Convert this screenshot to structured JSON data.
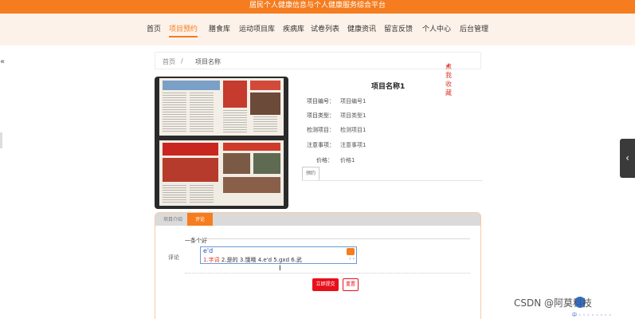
{
  "header": {
    "title": "居民个人健康信息与个人健康服务综合平台"
  },
  "nav": {
    "items": [
      {
        "label": "首页",
        "active": false
      },
      {
        "label": "项目预约",
        "active": true
      },
      {
        "label": "膳食库",
        "active": false
      },
      {
        "label": "运动项目库",
        "active": false
      },
      {
        "label": "疾病库",
        "active": false
      },
      {
        "label": "试卷列表",
        "active": false
      },
      {
        "label": "健康资讯",
        "active": false
      },
      {
        "label": "留言反馈",
        "active": false
      },
      {
        "label": "个人中心",
        "active": false
      },
      {
        "label": "后台管理",
        "active": false
      }
    ]
  },
  "left_arrow": "«",
  "breadcrumb": {
    "home": "首页",
    "separator": "/",
    "current": "项目名称",
    "favorite_label": "点我收藏",
    "favorite_icon": "star-icon"
  },
  "product": {
    "title": "项目名称1",
    "fields": [
      {
        "label": "项目编号：",
        "value": "项目编号1"
      },
      {
        "label": "项目类型：",
        "value": "项目类型1"
      },
      {
        "label": "检测项目：",
        "value": "检测项目1"
      },
      {
        "label": "注意事项：",
        "value": "注意事项1"
      },
      {
        "label": "价格：",
        "value": "价格1"
      }
    ],
    "small_tab": "预约"
  },
  "detail_tabs": [
    {
      "label": "项目介绍",
      "active": false
    },
    {
      "label": "评论",
      "active": true
    }
  ],
  "comment": {
    "hint": "一条个好",
    "label": "评论",
    "ime": {
      "input": "e'd",
      "candidates_first": "1.字词",
      "candidates_rest": " 2.是的  3.饿哦  4.e'd  5.gxd  6.武",
      "nav": "‹ ›",
      "logo_icon": "sogou-ime-icon"
    },
    "submit_label": "立即提交",
    "reset_label": "重置"
  },
  "side_handle": "‹",
  "watermark": "CSDN @阿莫科技",
  "taskbar_text": "中 ◦ ◦ ◦ ◦ ◦ ◦ ◦ ◦",
  "colors": {
    "brand": "#f57d1f",
    "nav_bg": "#fdf2ea",
    "submit": "#e8101b"
  }
}
